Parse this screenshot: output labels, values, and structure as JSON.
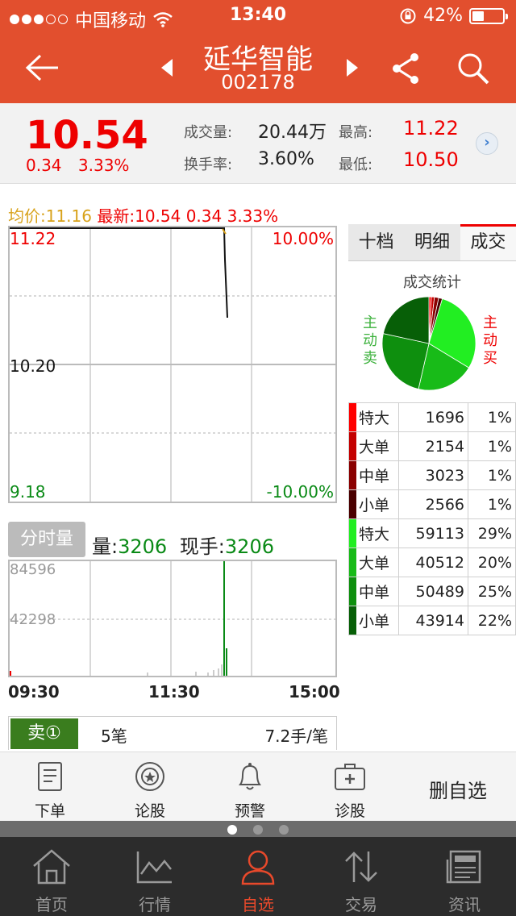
{
  "status_bar": {
    "carrier": "中国移动",
    "time": "13:40",
    "battery": "42%"
  },
  "header": {
    "back_icon": "arrow-left-icon",
    "stock_name": "延华智能",
    "stock_code": "002178",
    "share_icon": "share-icon",
    "search_icon": "search-icon"
  },
  "quote": {
    "price": "10.54",
    "change": "0.34",
    "change_pct": "3.33%",
    "volume_label": "成交量:",
    "volume": "20.44万",
    "turnover_label": "换手率:",
    "turnover": "3.60%",
    "high_label": "最高:",
    "high": "11.22",
    "low_label": "最低:",
    "low": "10.50"
  },
  "intraday": {
    "avg_label": "均价:11.16",
    "latest_label": "最新:10.54 0.34 3.33%",
    "y_top": "11.22",
    "y_mid": "10.20",
    "y_bot": "9.18",
    "pct_top": "10.00%",
    "pct_bot": "-10.00%",
    "tab_label": "分时量",
    "vol_label": "量:",
    "vol_value": "3206",
    "hand_label": "现手:",
    "hand_value": "3206",
    "vol_max": "84596",
    "vol_mid": "42298",
    "times": [
      "09:30",
      "11:30",
      "15:00"
    ],
    "colors": {
      "up": "#e00000",
      "down": "#0a8a16",
      "avg": "#d8a21a"
    }
  },
  "sell_row": {
    "label": "卖①",
    "count": "5笔",
    "avg": "7.2手/笔"
  },
  "right_panel": {
    "tabs": [
      "十档",
      "明细",
      "成交"
    ],
    "active_tab": "成交",
    "stats_title": "成交统计",
    "active_sell": "主动卖",
    "active_buy": "主动买",
    "rows": [
      {
        "label": "特大",
        "value": "1696",
        "pct": "1%",
        "color": "#ff0000"
      },
      {
        "label": "大单",
        "value": "2154",
        "pct": "1%",
        "color": "#c40000"
      },
      {
        "label": "中单",
        "value": "3023",
        "pct": "1%",
        "color": "#8a0000"
      },
      {
        "label": "小单",
        "value": "2566",
        "pct": "1%",
        "color": "#4a0000"
      },
      {
        "label": "特大",
        "value": "59113",
        "pct": "29%",
        "color": "#22ee22"
      },
      {
        "label": "大单",
        "value": "40512",
        "pct": "20%",
        "color": "#18bb18"
      },
      {
        "label": "中单",
        "value": "50489",
        "pct": "25%",
        "color": "#0e8f0e"
      },
      {
        "label": "小单",
        "value": "43914",
        "pct": "22%",
        "color": "#075f07"
      }
    ]
  },
  "actions": [
    {
      "label": "下单",
      "icon": "order-icon"
    },
    {
      "label": "论股",
      "icon": "discuss-icon"
    },
    {
      "label": "预警",
      "icon": "bell-icon"
    },
    {
      "label": "诊股",
      "icon": "diagnose-icon"
    }
  ],
  "delete_favorite": "删自选",
  "tabbar": [
    {
      "label": "首页",
      "icon": "home-icon"
    },
    {
      "label": "行情",
      "icon": "chart-icon"
    },
    {
      "label": "自选",
      "icon": "user-icon",
      "active": true
    },
    {
      "label": "交易",
      "icon": "transfer-icon"
    },
    {
      "label": "资讯",
      "icon": "news-icon"
    }
  ]
}
